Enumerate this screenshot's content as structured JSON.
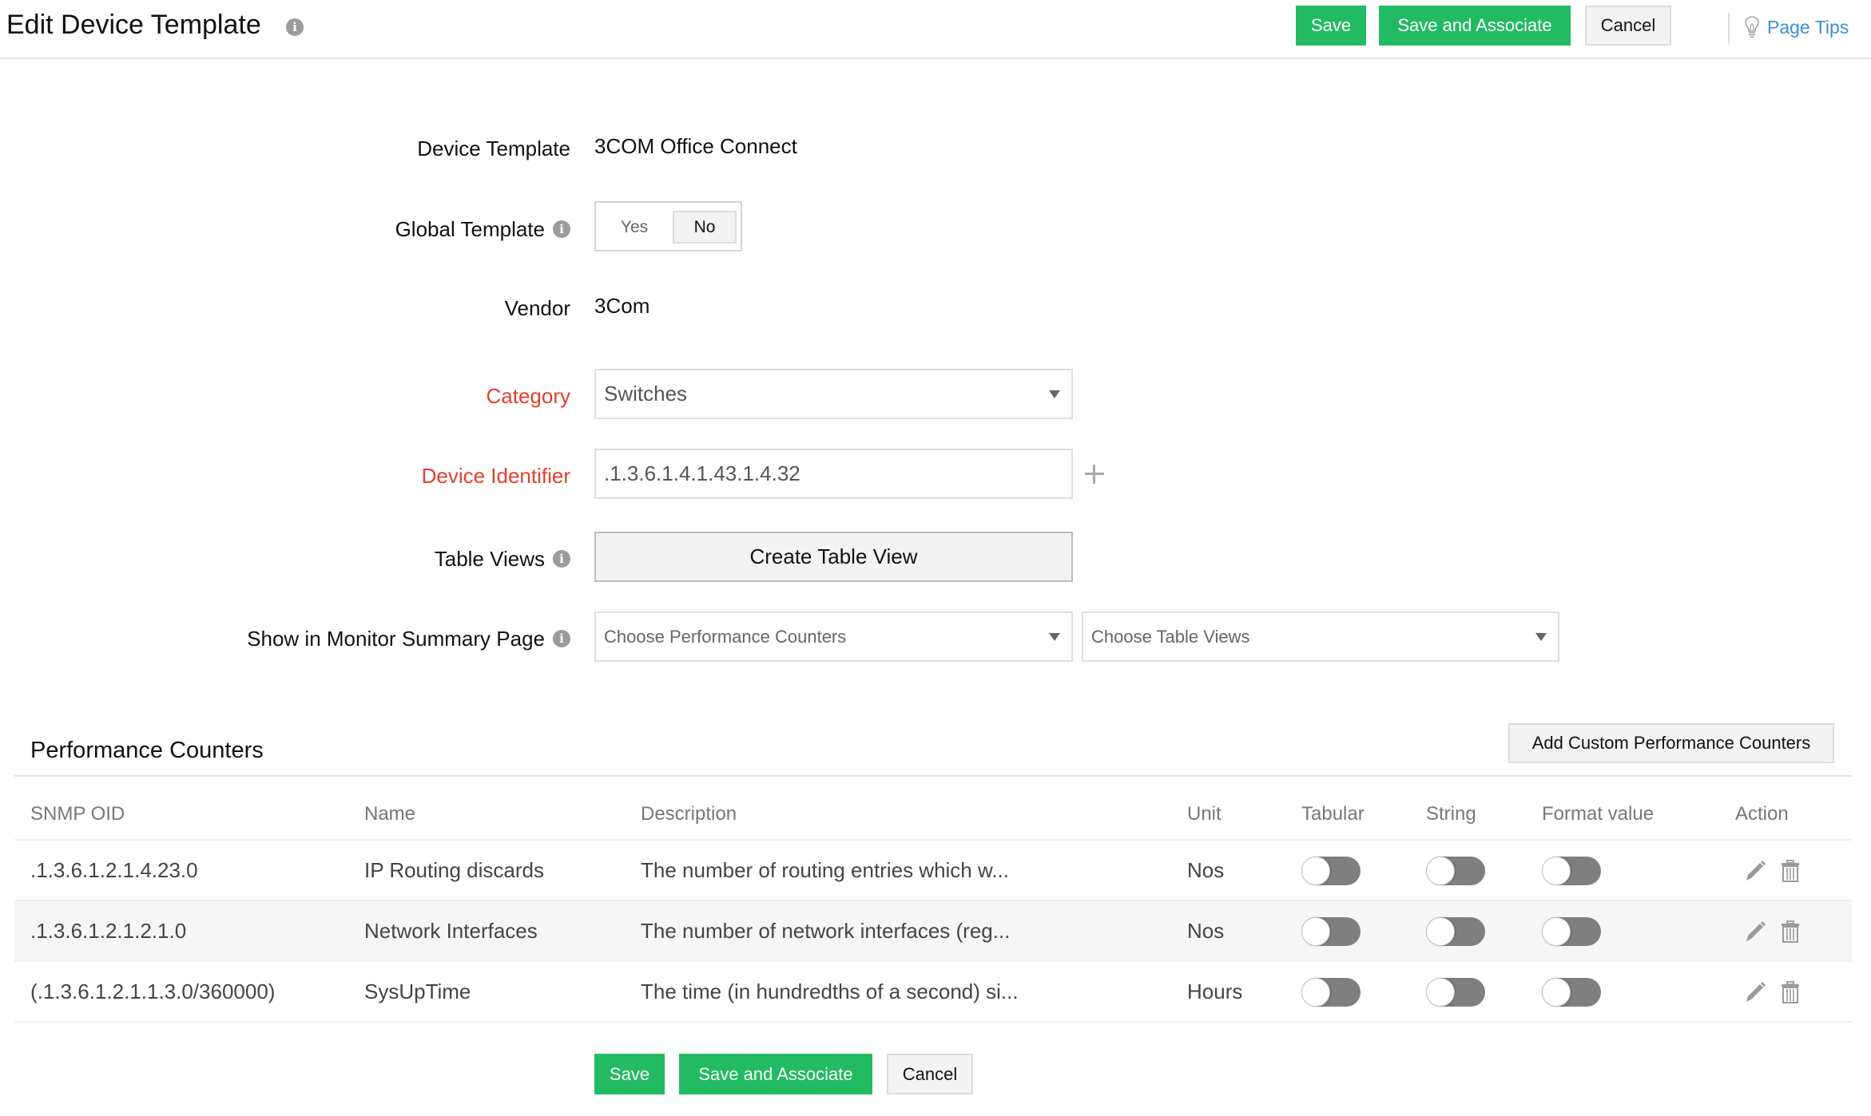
{
  "header": {
    "title": "Edit Device Template",
    "title_info_icon": "info-icon",
    "buttons": {
      "save": "Save",
      "save_associate": "Save and Associate",
      "cancel": "Cancel"
    },
    "page_tips": "Page Tips",
    "page_tips_icon": "lightbulb-icon"
  },
  "form": {
    "device_template": {
      "label": "Device Template",
      "value": "3COM Office Connect"
    },
    "global_template": {
      "label": "Global Template",
      "options": [
        "Yes",
        "No"
      ],
      "selected": "No"
    },
    "vendor": {
      "label": "Vendor",
      "value": "3Com"
    },
    "category": {
      "label": "Category",
      "value": "Switches",
      "required": true
    },
    "device_identifier": {
      "label": "Device Identifier",
      "value": ".1.3.6.1.4.1.43.1.4.32",
      "required": true
    },
    "table_views": {
      "label": "Table Views",
      "button": "Create Table View"
    },
    "monitor_summary": {
      "label": "Show in Monitor Summary Page",
      "performance_counters_placeholder": "Choose Performance Counters",
      "table_views_placeholder": "Choose Table Views"
    }
  },
  "performance_counters": {
    "title": "Performance Counters",
    "add_button": "Add Custom Performance Counters",
    "columns": [
      "SNMP OID",
      "Name",
      "Description",
      "Unit",
      "Tabular",
      "String",
      "Format value",
      "Action"
    ],
    "rows": [
      {
        "oid": ".1.3.6.1.2.1.4.23.0",
        "name": "IP Routing discards",
        "description": "The number of routing entries which w...",
        "unit": "Nos",
        "tabular": false,
        "string": false,
        "format_value": false
      },
      {
        "oid": ".1.3.6.1.2.1.2.1.0",
        "name": "Network Interfaces",
        "description": "The number of network interfaces (reg...",
        "unit": "Nos",
        "tabular": false,
        "string": false,
        "format_value": false
      },
      {
        "oid": "(.1.3.6.1.2.1.1.3.0/360000)",
        "name": "SysUpTime",
        "description": "The time (in hundredths of a second) si...",
        "unit": "Hours",
        "tabular": false,
        "string": false,
        "format_value": false
      }
    ],
    "action_icons": [
      "edit-icon",
      "delete-icon"
    ]
  },
  "footer": {
    "save": "Save",
    "save_associate": "Save and Associate",
    "cancel": "Cancel"
  },
  "colors": {
    "primary_green": "#22bb63",
    "required_red": "#e2402d",
    "link_blue": "#3d8fd1",
    "toggle_off": "#7f7f7f"
  }
}
